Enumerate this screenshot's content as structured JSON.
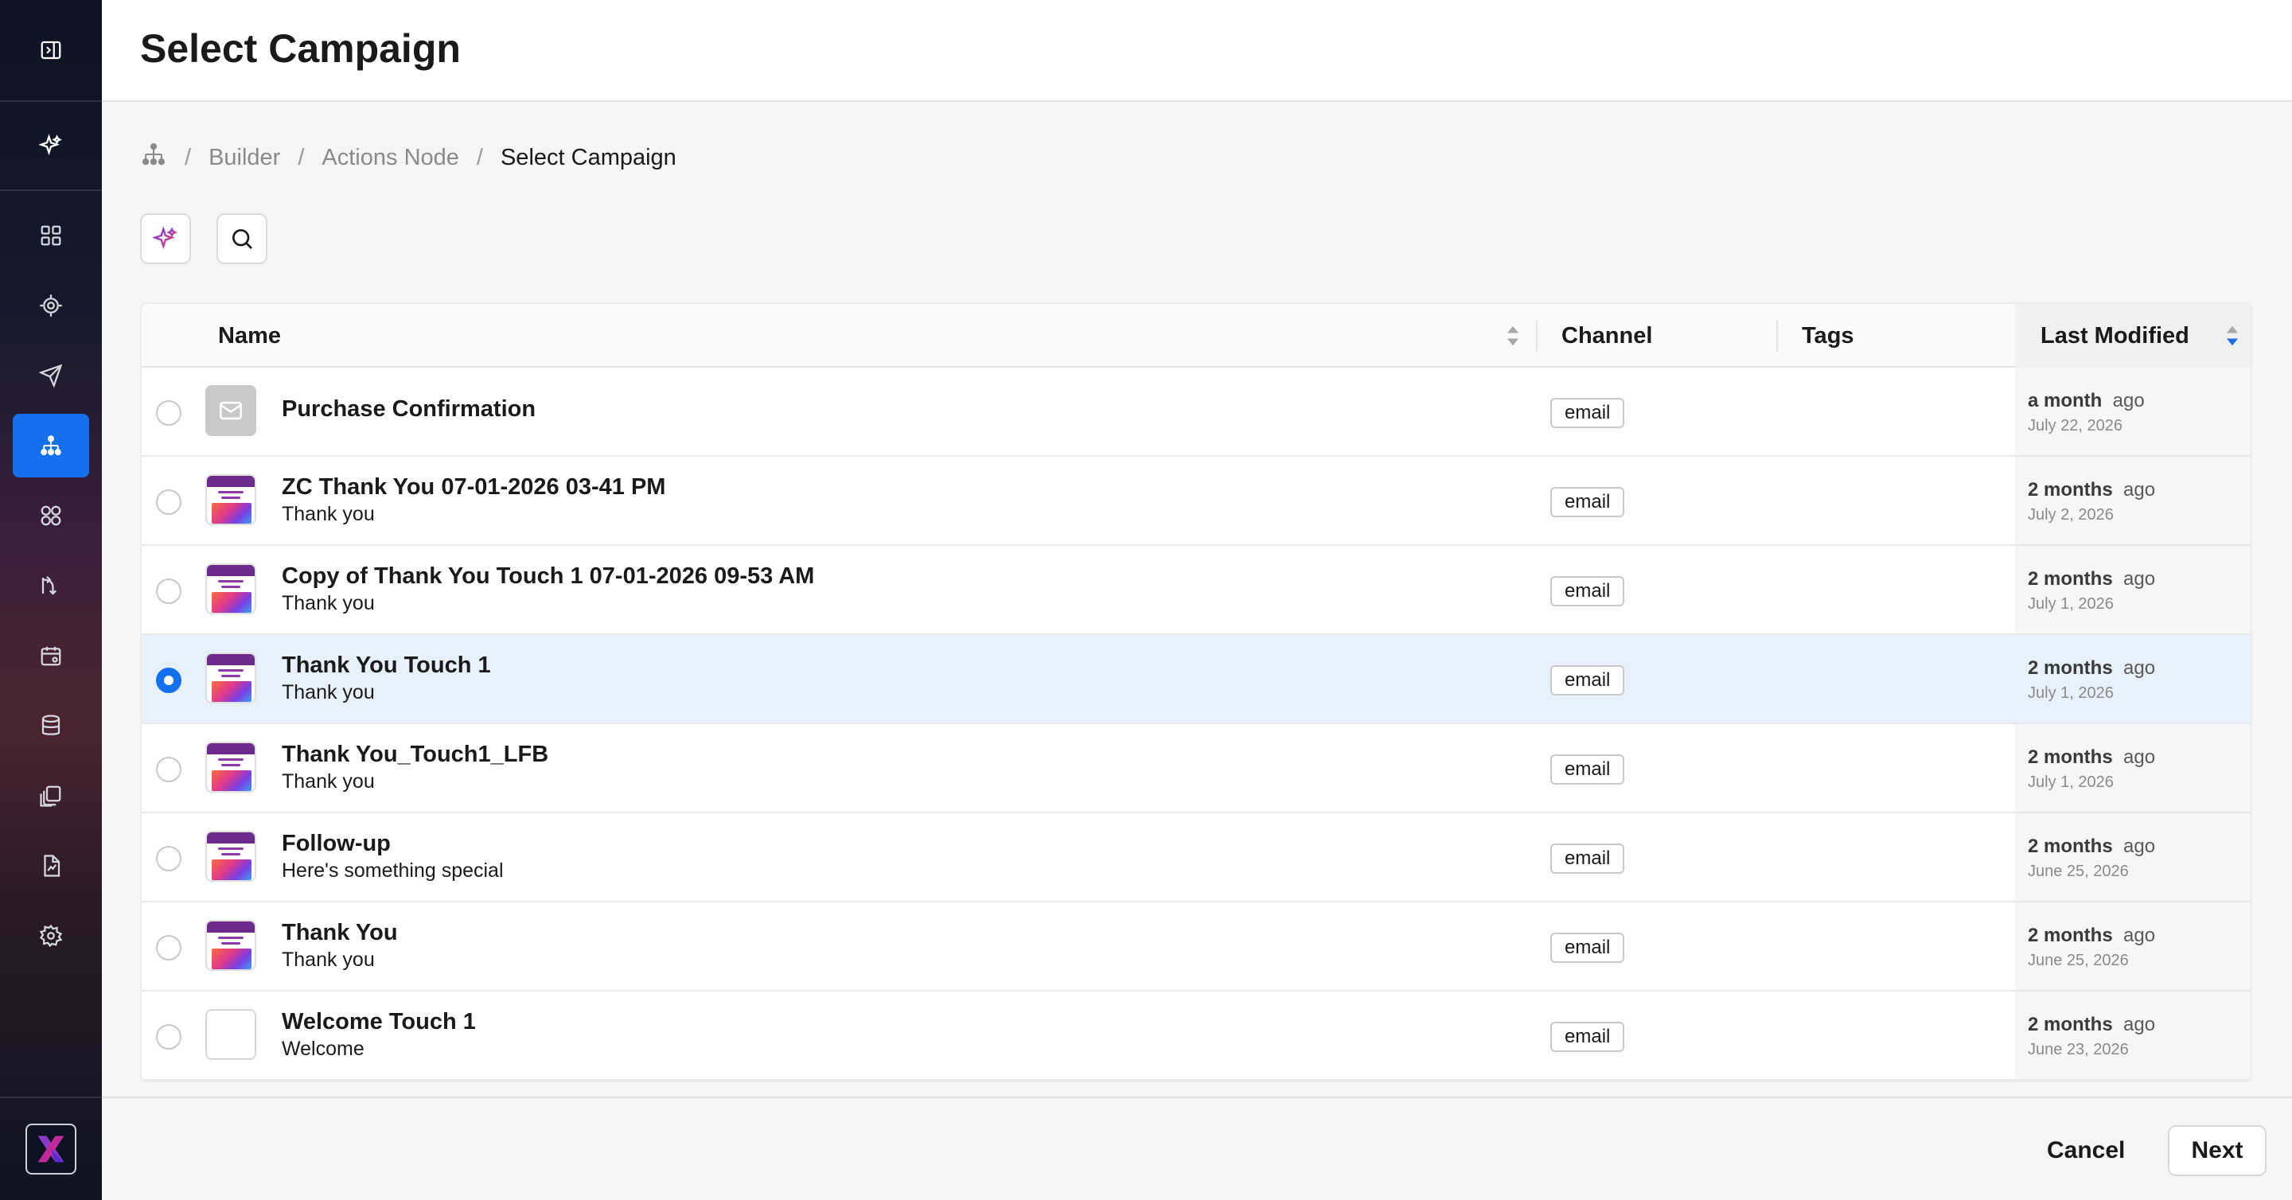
{
  "page": {
    "title": "Select Campaign"
  },
  "breadcrumb": {
    "items": [
      "Builder",
      "Actions Node"
    ],
    "current": "Select Campaign",
    "separator": "/"
  },
  "sidebar": {
    "items": [
      "collapse-icon",
      "ai-sparkle-icon",
      "dashboard-icon",
      "target-icon",
      "send-icon",
      "journey-icon",
      "segments-icon",
      "rules-icon",
      "calendar-icon",
      "database-icon",
      "library-icon",
      "reports-icon",
      "settings-icon"
    ],
    "active": "journey-icon",
    "accent": "#1570ef"
  },
  "table": {
    "columns": {
      "name": "Name",
      "channel": "Channel",
      "tags": "Tags",
      "last_modified": "Last Modified"
    },
    "rows": [
      {
        "name": "Purchase Confirmation",
        "subtitle": "",
        "channel": "email",
        "rel": "a month",
        "ago": "ago",
        "date": "July 22, 2026",
        "thumb": "mail",
        "selected": false
      },
      {
        "name": "ZC Thank You 07-01-2026 03-41 PM",
        "subtitle": "Thank you",
        "channel": "email",
        "rel": "2 months",
        "ago": "ago",
        "date": "July 2, 2026",
        "thumb": "image",
        "selected": false
      },
      {
        "name": "Copy of Thank You Touch 1 07-01-2026 09-53 AM",
        "subtitle": "Thank you",
        "channel": "email",
        "rel": "2 months",
        "ago": "ago",
        "date": "July 1, 2026",
        "thumb": "image",
        "selected": false
      },
      {
        "name": "Thank You Touch 1",
        "subtitle": "Thank you",
        "channel": "email",
        "rel": "2 months",
        "ago": "ago",
        "date": "July 1, 2026",
        "thumb": "image",
        "selected": true
      },
      {
        "name": "Thank You_Touch1_LFB",
        "subtitle": "Thank you",
        "channel": "email",
        "rel": "2 months",
        "ago": "ago",
        "date": "July 1, 2026",
        "thumb": "image",
        "selected": false
      },
      {
        "name": "Follow-up",
        "subtitle": "Here's something special",
        "channel": "email",
        "rel": "2 months",
        "ago": "ago",
        "date": "June 25, 2026",
        "thumb": "image",
        "selected": false
      },
      {
        "name": "Thank You",
        "subtitle": "Thank you",
        "channel": "email",
        "rel": "2 months",
        "ago": "ago",
        "date": "June 25, 2026",
        "thumb": "image",
        "selected": false
      },
      {
        "name": "Welcome Touch 1",
        "subtitle": "Welcome",
        "channel": "email",
        "rel": "2 months",
        "ago": "ago",
        "date": "June 23, 2026",
        "thumb": "blank",
        "selected": false
      }
    ]
  },
  "footer": {
    "cancel_label": "Cancel",
    "next_label": "Next"
  }
}
